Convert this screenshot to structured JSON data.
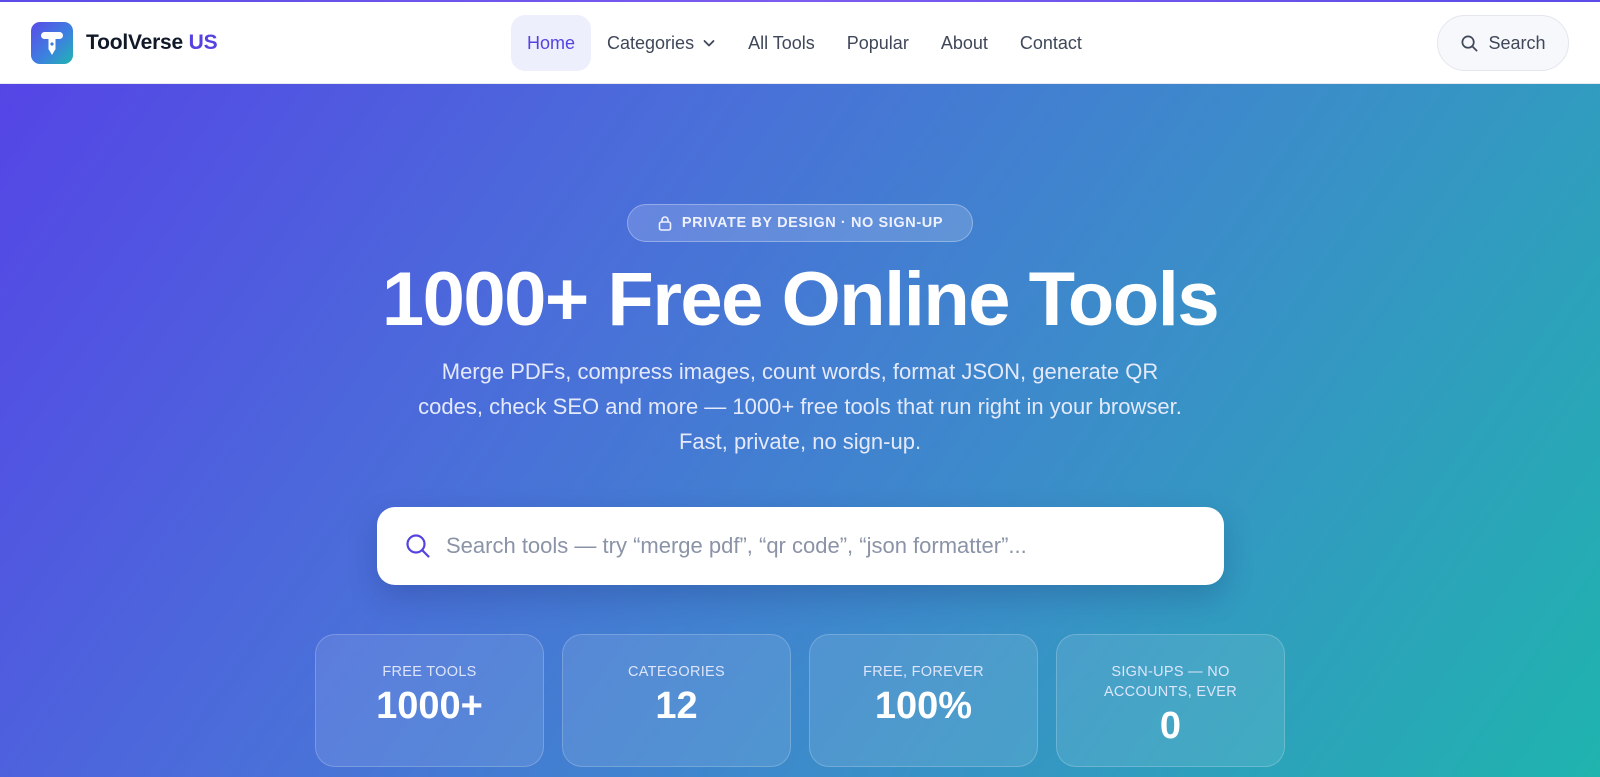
{
  "brand": {
    "name": "ToolVerse",
    "accent": "US",
    "logo_icon": "pen-tool-icon",
    "colors": {
      "accent": "#5443e0",
      "gradient_start": "#5545e6",
      "gradient_end": "#1fb4ae"
    }
  },
  "nav": {
    "items": [
      {
        "label": "Home",
        "active": true
      },
      {
        "label": "Categories",
        "has_dropdown": true,
        "icon": "chevron-down-icon"
      },
      {
        "label": "All Tools"
      },
      {
        "label": "Popular"
      },
      {
        "label": "About"
      },
      {
        "label": "Contact"
      }
    ]
  },
  "header_search": {
    "label": "Search",
    "icon": "search-icon"
  },
  "hero": {
    "badge": {
      "icon": "lock-icon",
      "text": "PRIVATE BY DESIGN · NO SIGN-UP"
    },
    "title": "1000+ Free Online Tools",
    "subtitle_lines": [
      "Merge PDFs, compress images, count words, format JSON, generate QR",
      "codes, check SEO and more — 1000+ free tools that run right in your browser.",
      "Fast, private, no sign-up."
    ],
    "search": {
      "icon": "search-icon",
      "placeholder": "Search tools — try “merge pdf”, “qr code”, “json formatter”..."
    }
  },
  "stats": [
    {
      "label": "FREE TOOLS",
      "value": "1000+"
    },
    {
      "label": "CATEGORIES",
      "value": "12"
    },
    {
      "label": "FREE, FOREVER",
      "value": "100%"
    },
    {
      "label": "SIGN-UPS — NO ACCOUNTS, EVER",
      "value": "0"
    }
  ]
}
